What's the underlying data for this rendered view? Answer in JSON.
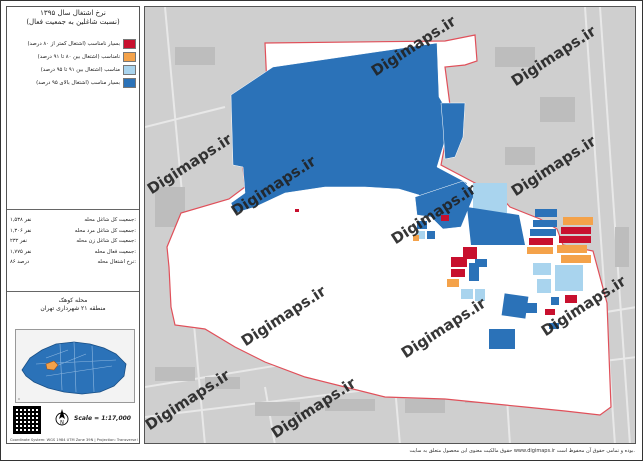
{
  "legend_panel": {
    "title_line1": "نرخ اشتغال سال ۱۳۹۵",
    "title_line2": "(نسبت شاغلین به جمعیت فعال)",
    "items": [
      {
        "label": "بسیار نامناسب (اشتغال کمتر از ۸۰ درصد)",
        "color": "#c8102e"
      },
      {
        "label": "نامناسب (اشتغال بین ۸۰ تا ۹۱ درصد)",
        "color": "#f4a24a"
      },
      {
        "label": "مناسب (اشتغال بین ۹۱ تا ۹۵ درصد)",
        "color": "#a9d4ee"
      },
      {
        "label": "بسیار مناسب (اشتغال بالای ۹۵ درصد)",
        "color": "#2b72b8"
      }
    ]
  },
  "stats": [
    {
      "key": "جمعیت کل شاغل محله:",
      "value": "۱,۵۳۸ نفر"
    },
    {
      "key": "جمعیت کل شاغل مرد محله:",
      "value": "۱,۳۰۶ نفر"
    },
    {
      "key": "جمعیت کل شاغل زن محله:",
      "value": "۲۳۲ نفر"
    },
    {
      "key": "جمعیت فعال محله:",
      "value": "۱,۷۷۵ نفر"
    },
    {
      "key": "نرخ اشتغال محله:",
      "value": "۸۶ درصد"
    }
  ],
  "region": {
    "line1": "محله کوهک",
    "line2": "منطقه ۲۱ شهرداری تهران"
  },
  "scale_text": "Scale = 1:17,000",
  "footer_tiny": "Coordinate System: WGS 1984 UTM Zone 39N | Projection: Transverse Mercator",
  "watermark": "Digimaps.ir",
  "credit": "حقوق مالکیت معنوی این محصول متعلق به سایت www.digimaps.ir بوده و تمامی حقوق آن محفوظ است.",
  "colors": {
    "very_poor": "#c8102e",
    "poor": "#f4a24a",
    "good": "#a9d4ee",
    "very_good": "#2b72b8",
    "boundary": "#e0505a",
    "basemap": "#cfcfcf"
  }
}
